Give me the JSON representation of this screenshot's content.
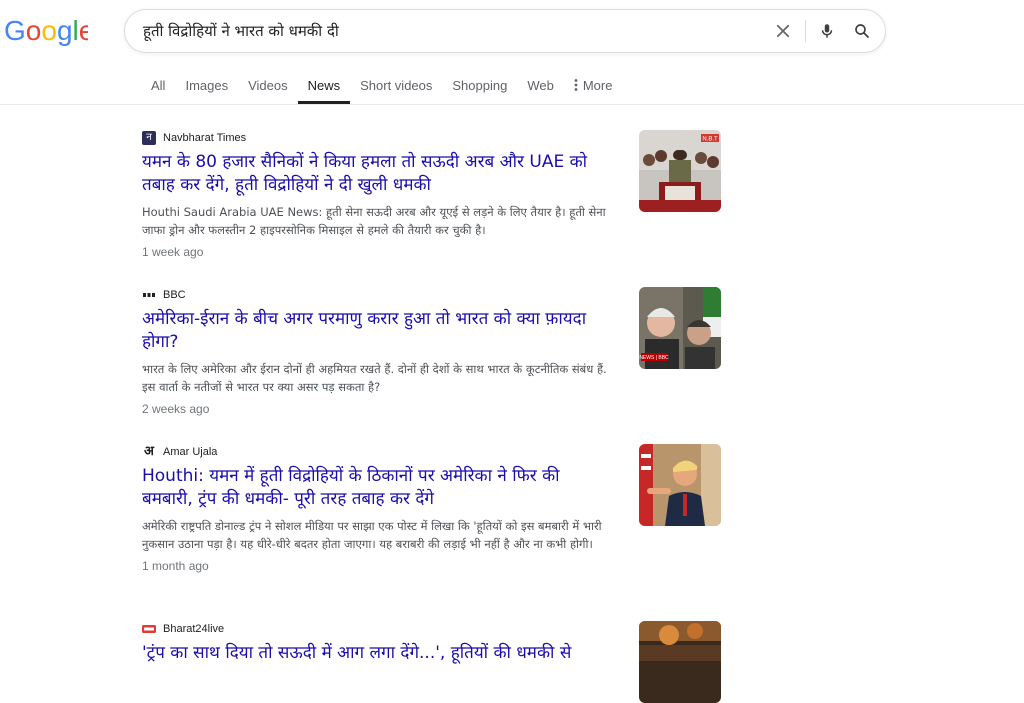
{
  "search": {
    "query": "हूती विद्रोहियों ने भारत को धमकी दी"
  },
  "tabs": [
    {
      "label": "All"
    },
    {
      "label": "Images"
    },
    {
      "label": "Videos"
    },
    {
      "label": "News"
    },
    {
      "label": "Short videos"
    },
    {
      "label": "Shopping"
    },
    {
      "label": "Web"
    },
    {
      "label": "More"
    }
  ],
  "colors": {
    "link": "#1a0dab",
    "snippet": "#4d5156",
    "meta": "#70757a",
    "border": "#dadce0"
  },
  "icons": {
    "logo": "google-logo",
    "clear": "close-icon",
    "voice": "microphone-icon",
    "search": "search-icon",
    "more": "more-vertical-icon"
  },
  "results": [
    {
      "source": "Navbharat Times",
      "favicon_glyph": "न",
      "headline": "यमन के 80 हजार सैनिकों ने किया हमला तो सऊदी अरब और UAE को तबाह कर देंगे, हूती विद्रोहियों ने दी खुली धमकी",
      "snippet": "Houthi Saudi Arabia UAE News: हूती सेना सऊदी अरब और यूएई से लड़ने के लिए तैयार है। हूती सेना जाफा ड्रोन और फलस्तीन 2 हाइपरसोनिक मिसाइल से हमले की तैयारी कर चुकी है।",
      "time": "1 week ago",
      "thumb_badge": "N.B.T"
    },
    {
      "source": "BBC",
      "favicon_glyph": "",
      "headline": "अमेरिका-ईरान के बीच अगर परमाणु करार हुआ तो भारत को क्या फ़ायदा होगा?",
      "snippet": "भारत के लिए अमेरिका और ईरान दोनों ही अहमियत रखते हैं. दोनों ही देशों के साथ भारत के कूटनीतिक संबंध हैं. इस वार्ता के नतीजों से भारत पर क्या असर पड़ सकता है?",
      "time": "2 weeks ago",
      "thumb_badge": "NEWS | BBC"
    },
    {
      "source": "Amar Ujala",
      "favicon_glyph": "अ",
      "headline": "Houthi: यमन में हूती विद्रोहियों के ठिकानों पर अमेरिका ने फिर की बमबारी, ट्रंप की धमकी- पूरी तरह तबाह कर देंगे",
      "snippet": "अमेरिकी राष्ट्रपति डोनाल्ड ट्रंप ने सोशल मीडिया पर साझा एक पोस्ट में लिखा कि 'हूतियों को इस बमबारी में भारी नुकसान उठाना पड़ा है। यह धीरे-धीरे बदतर होता जाएगा। यह बराबरी की लड़ाई भी नहीं है और ना कभी होगी।",
      "time": "1 month ago",
      "thumb_badge": ""
    },
    {
      "source": "Bharat24live",
      "favicon_glyph": "",
      "headline": "'ट्रंप का साथ दिया तो सऊदी में आग लगा देंगे...', हूतियों की धमकी से",
      "snippet": "",
      "time": "",
      "thumb_badge": ""
    }
  ]
}
